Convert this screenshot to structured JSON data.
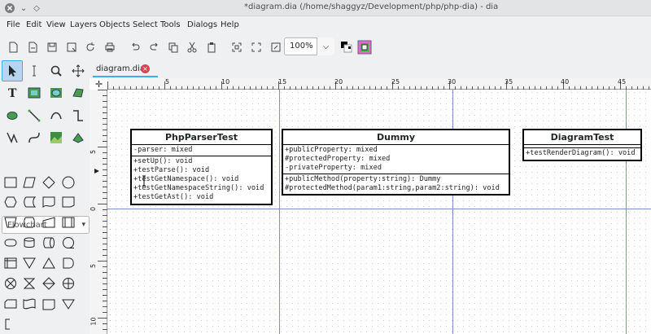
{
  "window": {
    "title": "*diagram.dia (/home/shaggyz/Development/php/php-dia) - dia"
  },
  "menubar": {
    "items": [
      "File",
      "Edit",
      "View",
      "Layers",
      "Objects",
      "Select",
      "Tools",
      "Dialogs",
      "Help"
    ]
  },
  "toolbar": {
    "zoom": "100%"
  },
  "toolbox": {
    "sheet": "Flowchart"
  },
  "tab": {
    "label": "diagram.dia"
  },
  "ruler": {
    "h_ticks": [
      "5",
      "10",
      "15",
      "20",
      "25",
      "30",
      "35",
      "40",
      "45"
    ],
    "v_ticks": [
      "5",
      "0",
      "5",
      "10"
    ]
  },
  "diagram": {
    "classes": [
      {
        "name": "PhpParserTest",
        "attributes": [
          "-parser: mixed"
        ],
        "operations": [
          "+setUp(): void",
          "+testParse(): void",
          "+testGetNamespace(): void",
          "+testGetNamespaceString(): void",
          "+testGetAst(): void"
        ]
      },
      {
        "name": "Dummy",
        "attributes": [
          "+publicProperty: mixed",
          "#protectedProperty: mixed",
          "-privateProperty: mixed"
        ],
        "operations": [
          "+publicMethod(property:string): Dummy",
          "#protectedMethod(param1:string,param2:string): void"
        ]
      },
      {
        "name": "DiagramTest",
        "attributes": [],
        "operations": [
          "+testRenderDiagram(): void"
        ]
      }
    ]
  }
}
